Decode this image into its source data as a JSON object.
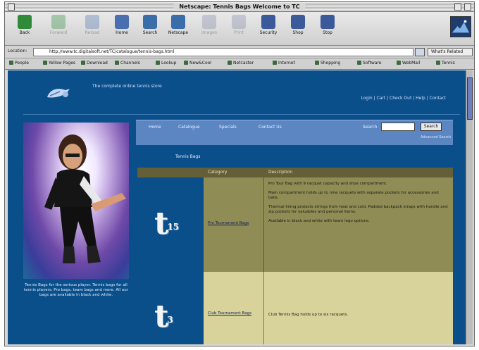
{
  "window": {
    "title": "Netscape: Tennis Bags Welcome to TC"
  },
  "toolbar": {
    "buttons": [
      {
        "label": "Back",
        "icon": "back-arrow-icon",
        "enabled": true,
        "color": "#2f8a3a"
      },
      {
        "label": "Forward",
        "icon": "forward-arrow-icon",
        "enabled": false,
        "color": "#2f8a3a"
      },
      {
        "label": "Reload",
        "icon": "reload-icon",
        "enabled": false,
        "color": "#4a6fb0"
      },
      {
        "label": "Home",
        "icon": "home-icon",
        "enabled": true,
        "color": "#4a6fb0"
      },
      {
        "label": "Search",
        "icon": "search-icon",
        "enabled": true,
        "color": "#3b6ea8"
      },
      {
        "label": "Netscape",
        "icon": "netscape-icon",
        "enabled": true,
        "color": "#3b6ea8"
      },
      {
        "label": "Images",
        "icon": "images-icon",
        "enabled": false,
        "color": "#7a8aa8"
      },
      {
        "label": "Print",
        "icon": "print-icon",
        "enabled": false,
        "color": "#7a8aa8"
      },
      {
        "label": "Security",
        "icon": "lock-icon",
        "enabled": true,
        "color": "#3b5a9a"
      },
      {
        "label": "Shop",
        "icon": "shop-icon",
        "enabled": true,
        "color": "#3b5a9a"
      },
      {
        "label": "Stop",
        "icon": "stop-icon",
        "enabled": true,
        "color": "#3b5a9a"
      }
    ]
  },
  "location": {
    "label": "Location:",
    "url": "http://www.tc.digitalsoft.net/TC/catalogue/tennis-bags.html",
    "related_label": "What's Related"
  },
  "bookmarks": {
    "items": [
      "People",
      "Yellow Pages",
      "Download",
      "Channels",
      "Lookup",
      "New&Cool",
      "Netcaster",
      "Internet",
      "Shopping",
      "Software",
      "WebMail",
      "Tennis"
    ]
  },
  "site": {
    "tagline": "The complete online tennis store",
    "top_right": "Login | Cart | Check Out | Help | Contact",
    "nav": [
      "Home",
      "Catalogue",
      "Specials",
      "Contact Us"
    ],
    "search_label": "Search",
    "search_button": "Search",
    "advanced_link": "Advanced Search",
    "section_label": "Tennis Bags",
    "table_headers": [
      "Category",
      "Description"
    ],
    "caption": "Tennis Bags for the serious player. Tennis bags for all tennis players. Pro bags, team bags and more. All our bags are available in black and white.",
    "rows": [
      {
        "category": "Pro Tournament Bags",
        "paragraphs": [
          "Pro Tour Bag with 9 racquet capacity and shoe compartment.",
          "Main compartment holds up to nine racquets with separate pockets for accessories and balls.",
          "Thermal lining protects strings from heat and cold. Padded backpack straps with handle and zip pockets for valuables and personal items.",
          "Available in black and white with team logo options."
        ]
      },
      {
        "category": "Club Tournament Bags",
        "paragraphs": [
          "Club Tennis Bag holds up to six racquets."
        ]
      }
    ]
  },
  "colors": {
    "page_bg": "#0a4f8a",
    "nav_bg": "#5b86c2",
    "table_head": "#635f36",
    "row1_bg": "#8f8c55",
    "row2_bg": "#d7d39a"
  }
}
